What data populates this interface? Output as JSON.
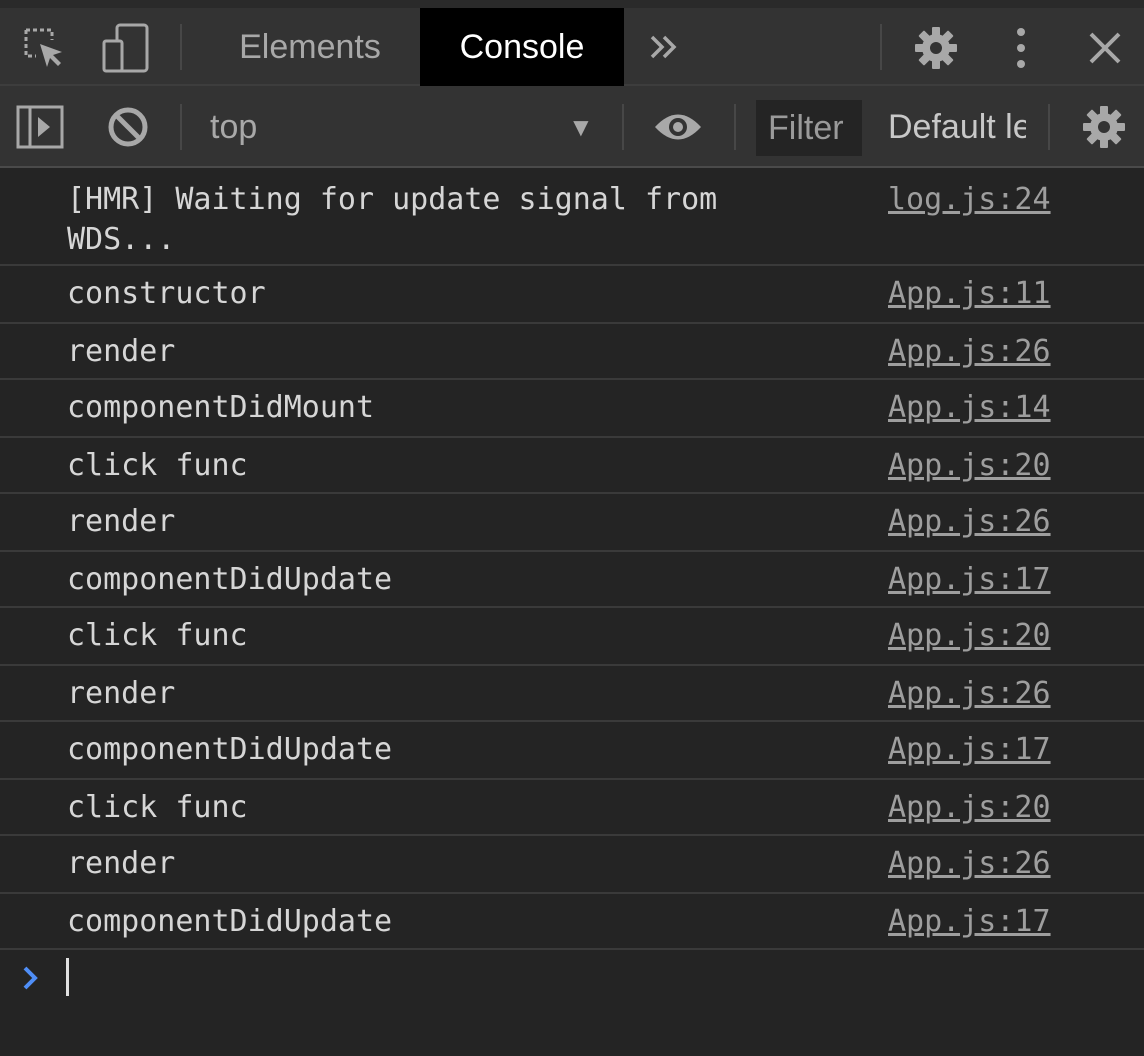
{
  "tabbar": {
    "icons": [
      "inspect-element-icon",
      "device-toolbar-icon",
      "more-tabs-icon",
      "settings-gear-icon",
      "kebab-menu-icon",
      "close-icon"
    ],
    "tabs": [
      {
        "label": "Elements",
        "active": false
      },
      {
        "label": "Console",
        "active": true
      }
    ]
  },
  "toolbar": {
    "context": "top",
    "filter_placeholder": "Filter",
    "levels": "Default levels",
    "icons": [
      "sidebar-toggle-icon",
      "clear-console-icon",
      "dropdown-arrow-icon",
      "live-expression-eye-icon",
      "console-settings-gear-icon"
    ]
  },
  "log": [
    {
      "message": "[HMR] Waiting for update signal from WDS...",
      "source": "log.js:24"
    },
    {
      "message": "constructor",
      "source": "App.js:11"
    },
    {
      "message": "render",
      "source": "App.js:26"
    },
    {
      "message": "componentDidMount",
      "source": "App.js:14"
    },
    {
      "message": "click func",
      "source": "App.js:20"
    },
    {
      "message": "render",
      "source": "App.js:26"
    },
    {
      "message": "componentDidUpdate",
      "source": "App.js:17"
    },
    {
      "message": "click func",
      "source": "App.js:20"
    },
    {
      "message": "render",
      "source": "App.js:26"
    },
    {
      "message": "componentDidUpdate",
      "source": "App.js:17"
    },
    {
      "message": "click func",
      "source": "App.js:20"
    },
    {
      "message": "render",
      "source": "App.js:26"
    },
    {
      "message": "componentDidUpdate",
      "source": "App.js:17"
    }
  ],
  "colors": {
    "background": "#242424",
    "toolbar": "#333333",
    "active_tab": "#000000",
    "prompt_accent": "#4f8ef7"
  }
}
